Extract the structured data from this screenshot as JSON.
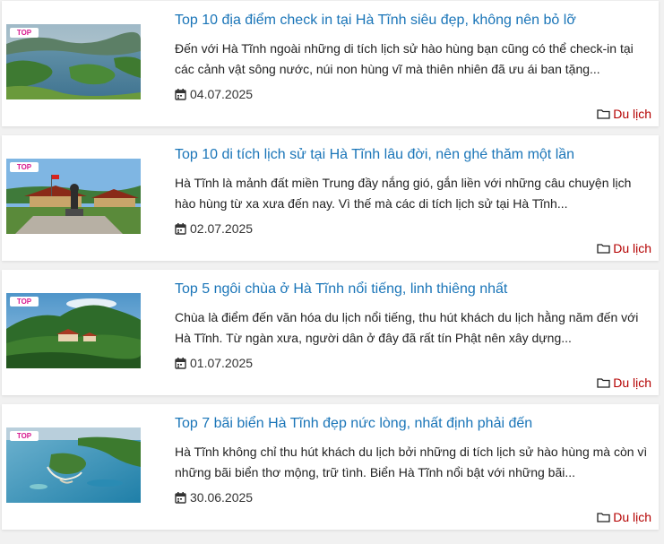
{
  "colors": {
    "title": "#1a75b8",
    "category": "#b40000",
    "card_bg": "#ffffff",
    "page_bg": "#f1f1f1"
  },
  "icons": {
    "date": "calendar-icon",
    "category": "folder-icon"
  },
  "posts": [
    {
      "title": "Top 10 địa điểm check in tại Hà Tĩnh siêu đẹp, không nên bỏ lỡ",
      "excerpt": "Đến với Hà Tĩnh ngoài những di tích lịch sử hào hùng bạn cũng có thể check-in tại các cảnh vật sông nước, núi non hùng vĩ mà thiên nhiên đã ưu ái ban tặng...",
      "date": "04.07.2025",
      "category": "Du lịch",
      "thumb_badge": "TOP"
    },
    {
      "title": "Top 10 di tích lịch sử tại Hà Tĩnh lâu đời, nên ghé thăm một lần",
      "excerpt": "Hà Tĩnh là mảnh đất miền Trung đầy nắng gió, gắn liền với những câu chuyện lịch hào hùng từ xa xưa đến nay. Vì thế mà các di tích lịch sử tại Hà Tĩnh...",
      "date": "02.07.2025",
      "category": "Du lịch",
      "thumb_badge": "TOP"
    },
    {
      "title": "Top 5 ngôi chùa ở Hà Tĩnh nổi tiếng, linh thiêng nhất",
      "excerpt": "Chùa là điểm đến văn hóa du lịch nổi tiếng, thu hút khách du lịch hằng năm đến với Hà Tĩnh. Từ ngàn xưa, người dân ở đây đã rất tín Phật nên xây dựng...",
      "date": "01.07.2025",
      "category": "Du lịch",
      "thumb_badge": "TOP"
    },
    {
      "title": "Top 7 bãi biển Hà Tĩnh đẹp nức lòng, nhất định phải đến",
      "excerpt": "Hà Tĩnh không chỉ thu hút khách du lịch bởi những di tích lịch sử hào hùng mà còn vì những bãi biển thơ mộng, trữ tình. Biển Hà Tĩnh nổi bật với những bãi...",
      "date": "30.06.2025",
      "category": "Du lịch",
      "thumb_badge": "TOP"
    }
  ]
}
